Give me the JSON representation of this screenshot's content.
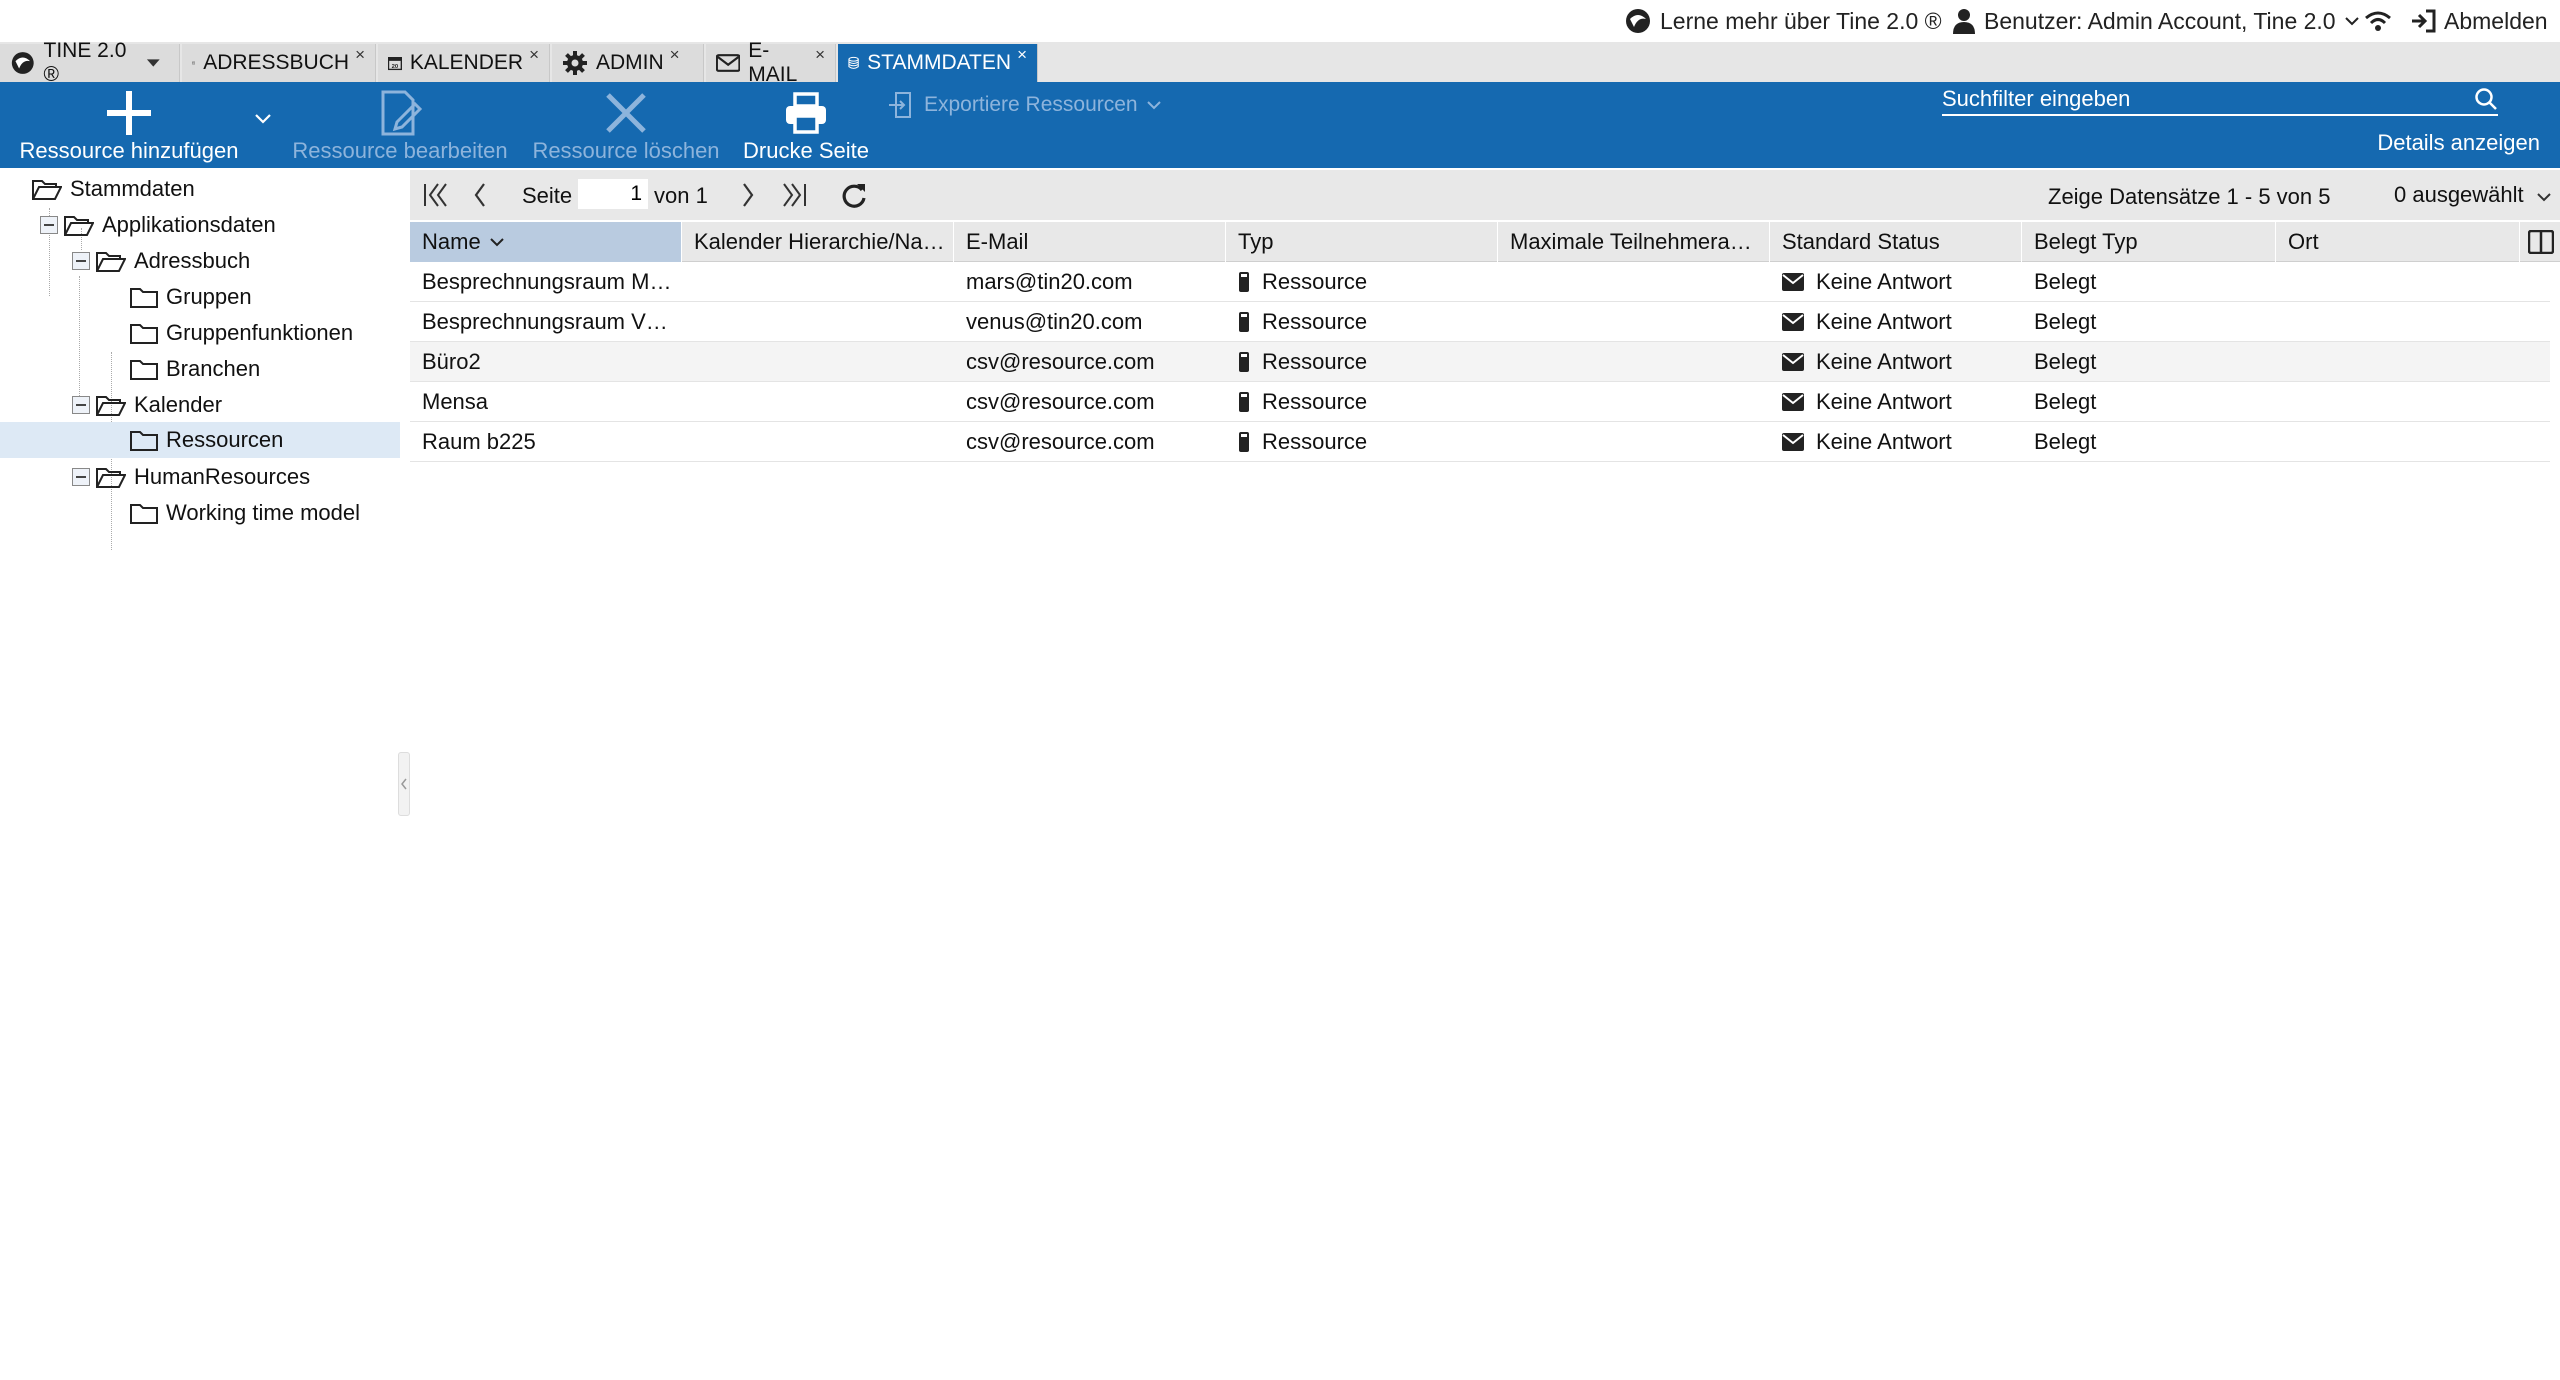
{
  "topbar": {
    "learn_more": "Lerne mehr über Tine 2.0 ®",
    "user": "Benutzer: Admin Account, Tine 2.0",
    "logout": "Abmelden"
  },
  "tabs": [
    {
      "label": "TINE 2.0 ®",
      "icon": "tine-logo-icon"
    },
    {
      "label": "ADRESSBUCH",
      "icon": "address-card-icon",
      "close": "×"
    },
    {
      "label": "KALENDER",
      "icon": "calendar-icon",
      "close": "×"
    },
    {
      "label": "ADMIN",
      "icon": "gear-icon",
      "close": "×"
    },
    {
      "label": "E-MAIL",
      "icon": "envelope-icon",
      "close": "×"
    },
    {
      "label": "STAMMDATEN",
      "icon": "database-icon",
      "close": "×"
    }
  ],
  "toolbar": {
    "add": "Ressource hinzufügen",
    "edit": "Ressource bearbeiten",
    "delete": "Ressource löschen",
    "print": "Drucke Seite",
    "export": "Exportiere Ressourcen",
    "search_placeholder": "Suchfilter eingeben",
    "details": "Details anzeigen"
  },
  "tree": {
    "root": "Stammdaten",
    "app_data": "Applikationsdaten",
    "addressbook": "Adressbuch",
    "groups": "Gruppen",
    "group_functions": "Gruppenfunktionen",
    "branches": "Branchen",
    "calendar": "Kalender",
    "resources": "Ressourcen",
    "hr": "HumanResources",
    "working_time": "Working time model"
  },
  "pager": {
    "page_label": "Seite",
    "page_value": "1",
    "of_label": "von 1",
    "summary": "Zeige Datensätze 1 - 5 von 5",
    "selected": "0 ausgewählt"
  },
  "columns": [
    "Name",
    "Kalender Hierarchie/Na…",
    "E-Mail",
    "Typ",
    "Maximale Teilnehmera…",
    "Standard Status",
    "Belegt Typ",
    "Ort"
  ],
  "rows": [
    {
      "name": "Besprechnungsraum M…",
      "hierarchy": "",
      "email": "mars@tin20.com",
      "type": "Ressource",
      "max": "",
      "status": "Keine Antwort",
      "busy": "Belegt",
      "location": ""
    },
    {
      "name": "Besprechnungsraum V…",
      "hierarchy": "",
      "email": "venus@tin20.com",
      "type": "Ressource",
      "max": "",
      "status": "Keine Antwort",
      "busy": "Belegt",
      "location": ""
    },
    {
      "name": "Büro2",
      "hierarchy": "",
      "email": "csv@resource.com",
      "type": "Ressource",
      "max": "",
      "status": "Keine Antwort",
      "busy": "Belegt",
      "location": ""
    },
    {
      "name": "Mensa",
      "hierarchy": "",
      "email": "csv@resource.com",
      "type": "Ressource",
      "max": "",
      "status": "Keine Antwort",
      "busy": "Belegt",
      "location": ""
    },
    {
      "name": "Raum b225",
      "hierarchy": "",
      "email": "csv@resource.com",
      "type": "Ressource",
      "max": "",
      "status": "Keine Antwort",
      "busy": "Belegt",
      "location": ""
    }
  ],
  "colors": {
    "accent": "#1569b0",
    "selection": "#dde9f5"
  }
}
